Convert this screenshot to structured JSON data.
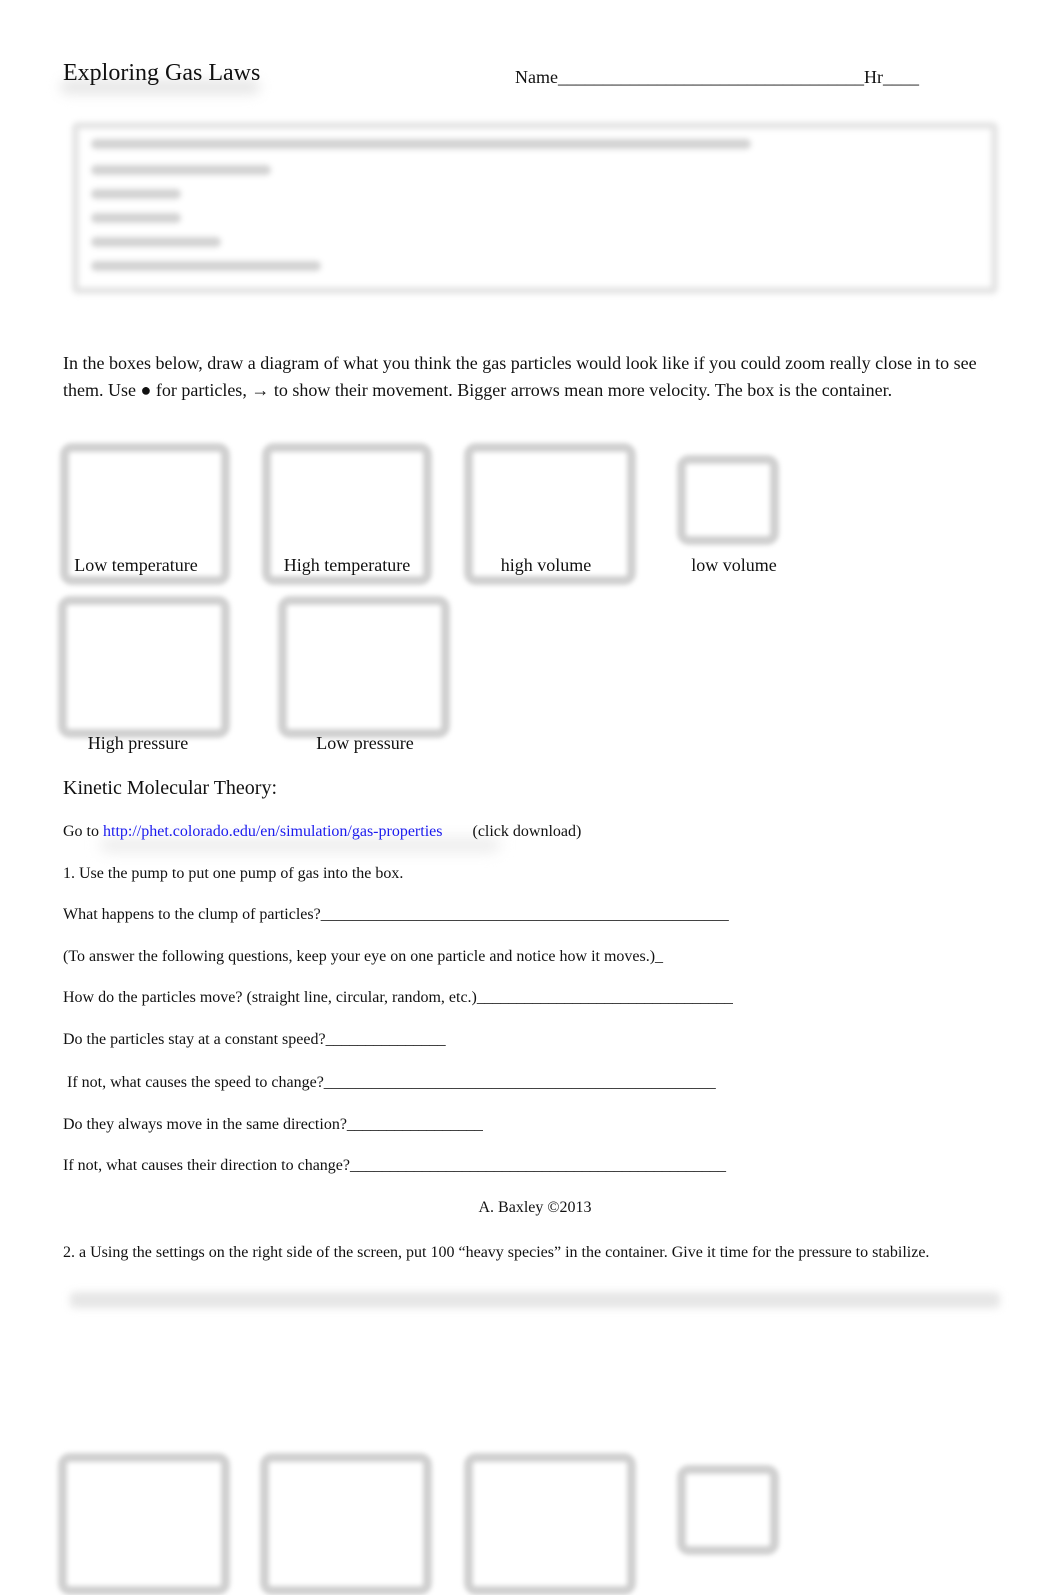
{
  "header": {
    "title": "Exploring Gas Laws",
    "name_field": "Name__________________________________Hr____"
  },
  "objectives_box": {
    "blurred": true
  },
  "instructions": "In the boxes below, draw a diagram of what you think the gas particles would look like if you could zoom really close in to see them. Use ● for particles, → to show their movement.    Bigger arrows mean more velocity. The box is the container.",
  "diagram_boxes": [
    {
      "label": "Low temperature"
    },
    {
      "label": "High temperature"
    },
    {
      "label": "high volume"
    },
    {
      "label": "low volume"
    },
    {
      "label": "High pressure"
    },
    {
      "label": "Low pressure"
    }
  ],
  "kmt": {
    "heading": "Kinetic Molecular Theory:",
    "goto_prefix": "Go to ",
    "link_text": "http://phet.colorado.edu/en/simulation/gas-properties",
    "goto_suffix": "(click download)",
    "link_color": "#1a1aee"
  },
  "questions": [
    "1. Use the pump to put one pump of gas into the box.",
    "What happens to the clump of particles?___________________________________________________",
    "(To answer the following questions, keep your eye on one particle and notice how it moves.)_",
    "How do the particles move? (straight line, circular, random, etc.)________________________________",
    "Do the particles stay at a constant speed?_______________",
    " If not, what causes the speed to change?_________________________________________________",
    "Do they always move in the same direction?_________________",
    "If not, what causes their direction to change?_______________________________________________"
  ],
  "credit": "A. Baxley ©2013",
  "question2": "2. a Using the settings on the right side of the screen, put 100 “heavy species” in the container. Give it time for the pressure to stabilize."
}
